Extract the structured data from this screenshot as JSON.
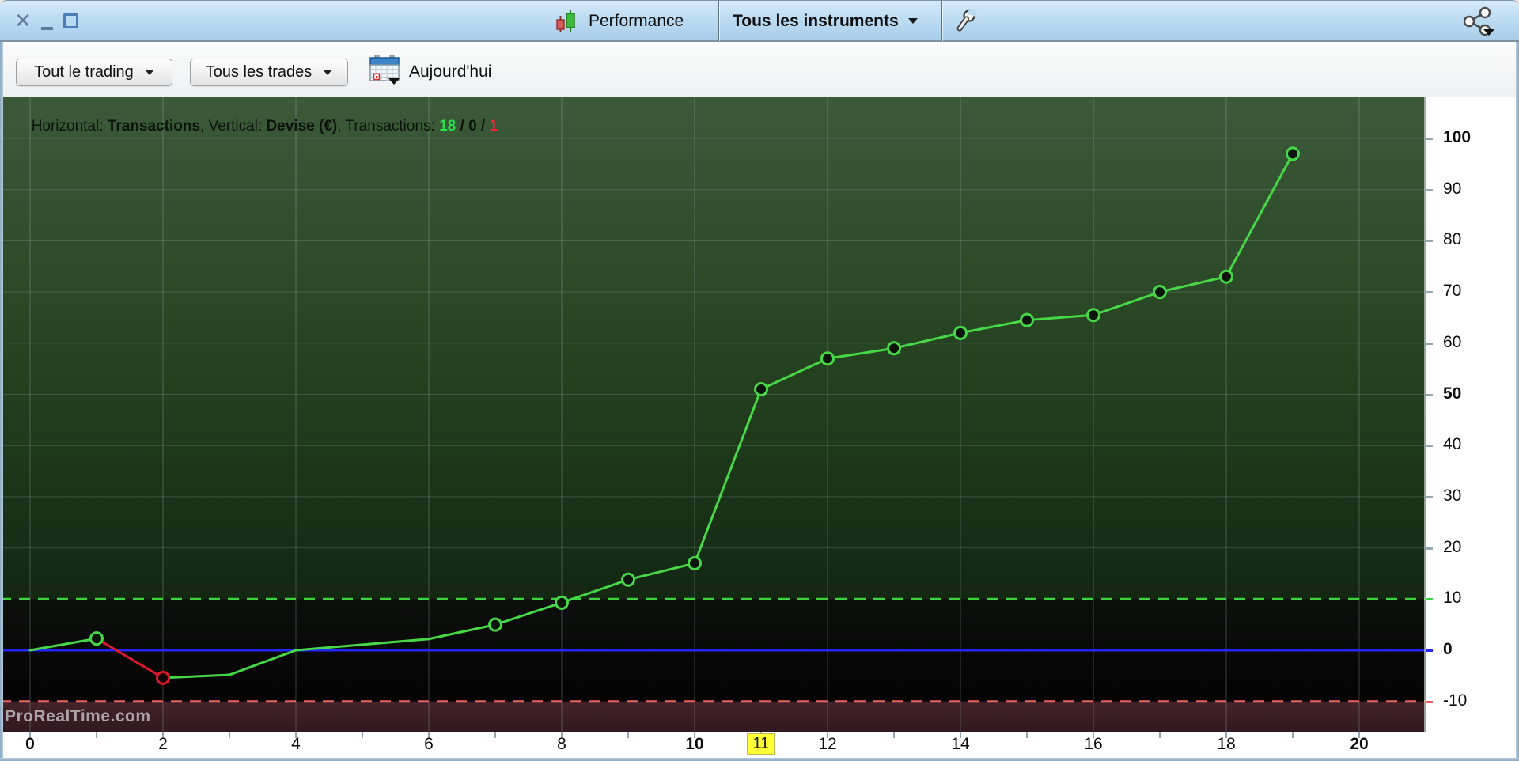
{
  "titlebar": {
    "close_glyph": "✕",
    "performance_label": "Performance",
    "instrument_selector": "Tous les instruments"
  },
  "toolbar": {
    "trading_scope_button": "Tout le trading",
    "trades_filter_button": "Tous les trades",
    "date_label": "Aujourd'hui"
  },
  "info_bar": {
    "h_label": "Horizontal: ",
    "h_value": "Transactions",
    "sep_a": ", ",
    "v_label": "Vertical: ",
    "v_value": "Devise (€)",
    "sep_b": ", ",
    "t_label": "Transactions: ",
    "wins": "18",
    "slash1": " / ",
    "neutral": "0",
    "slash2": " / ",
    "losses": "1"
  },
  "watermark": "ProRealTime.com",
  "chart_data": {
    "type": "line",
    "x_label": "Transactions",
    "y_label": "Devise (€)",
    "points": [
      {
        "t": 0,
        "v": 0
      },
      {
        "t": 1,
        "v": 2.3
      },
      {
        "t": 2,
        "v": -5.4
      },
      {
        "t": 3,
        "v": -4.8
      },
      {
        "t": 4,
        "v": 0
      },
      {
        "t": 5,
        "v": 1.1
      },
      {
        "t": 6,
        "v": 2.2
      },
      {
        "t": 7,
        "v": 5
      },
      {
        "t": 8,
        "v": 9.3
      },
      {
        "t": 9,
        "v": 13.8
      },
      {
        "t": 10,
        "v": 17
      },
      {
        "t": 11,
        "v": 51
      },
      {
        "t": 12,
        "v": 57
      },
      {
        "t": 13,
        "v": 59
      },
      {
        "t": 14,
        "v": 62
      },
      {
        "t": 15,
        "v": 64.5
      },
      {
        "t": 16,
        "v": 65.5
      },
      {
        "t": 17,
        "v": 70
      },
      {
        "t": 18,
        "v": 73
      },
      {
        "t": 19,
        "v": 97
      }
    ],
    "markers": [
      {
        "t": 1,
        "result": "win"
      },
      {
        "t": 2,
        "result": "loss"
      },
      {
        "t": 7,
        "result": "win"
      },
      {
        "t": 8,
        "result": "win"
      },
      {
        "t": 9,
        "result": "win"
      },
      {
        "t": 10,
        "result": "win"
      },
      {
        "t": 11,
        "result": "win"
      },
      {
        "t": 12,
        "result": "win"
      },
      {
        "t": 13,
        "result": "win"
      },
      {
        "t": 14,
        "result": "win"
      },
      {
        "t": 15,
        "result": "win"
      },
      {
        "t": 16,
        "result": "win"
      },
      {
        "t": 17,
        "result": "win"
      },
      {
        "t": 18,
        "result": "win"
      },
      {
        "t": 19,
        "result": "win"
      }
    ],
    "loss_segments": [
      [
        1,
        2
      ]
    ],
    "x_axis": {
      "range": [
        0,
        21
      ],
      "tick_step": 1,
      "labels": [
        0,
        2,
        4,
        6,
        8,
        10,
        12,
        14,
        16,
        18,
        20
      ],
      "bold_labels": [
        0,
        10,
        20
      ],
      "highlighted_label": 11
    },
    "y_axis": {
      "range": [
        -16,
        108
      ],
      "ticks": [
        -10,
        0,
        10,
        20,
        30,
        40,
        50,
        60,
        70,
        80,
        90,
        100
      ],
      "bold_labels": [
        0,
        50,
        100
      ]
    },
    "reference_lines": {
      "zero_line": 0,
      "profit_dashed": 10,
      "loss_dashed": -10
    },
    "colors": {
      "line": "#47d847",
      "loss_line": "#d61a2c",
      "marker_win_ring": "#47d847",
      "marker_loss_ring": "#e0182e",
      "zero_line": "#2525ff",
      "profit_dashed": "#3fd43f",
      "loss_dashed": "#e86262",
      "win_text": "#27e24b",
      "loss_text": "#ff1f35",
      "highlight_bg": "#ffff35"
    }
  }
}
